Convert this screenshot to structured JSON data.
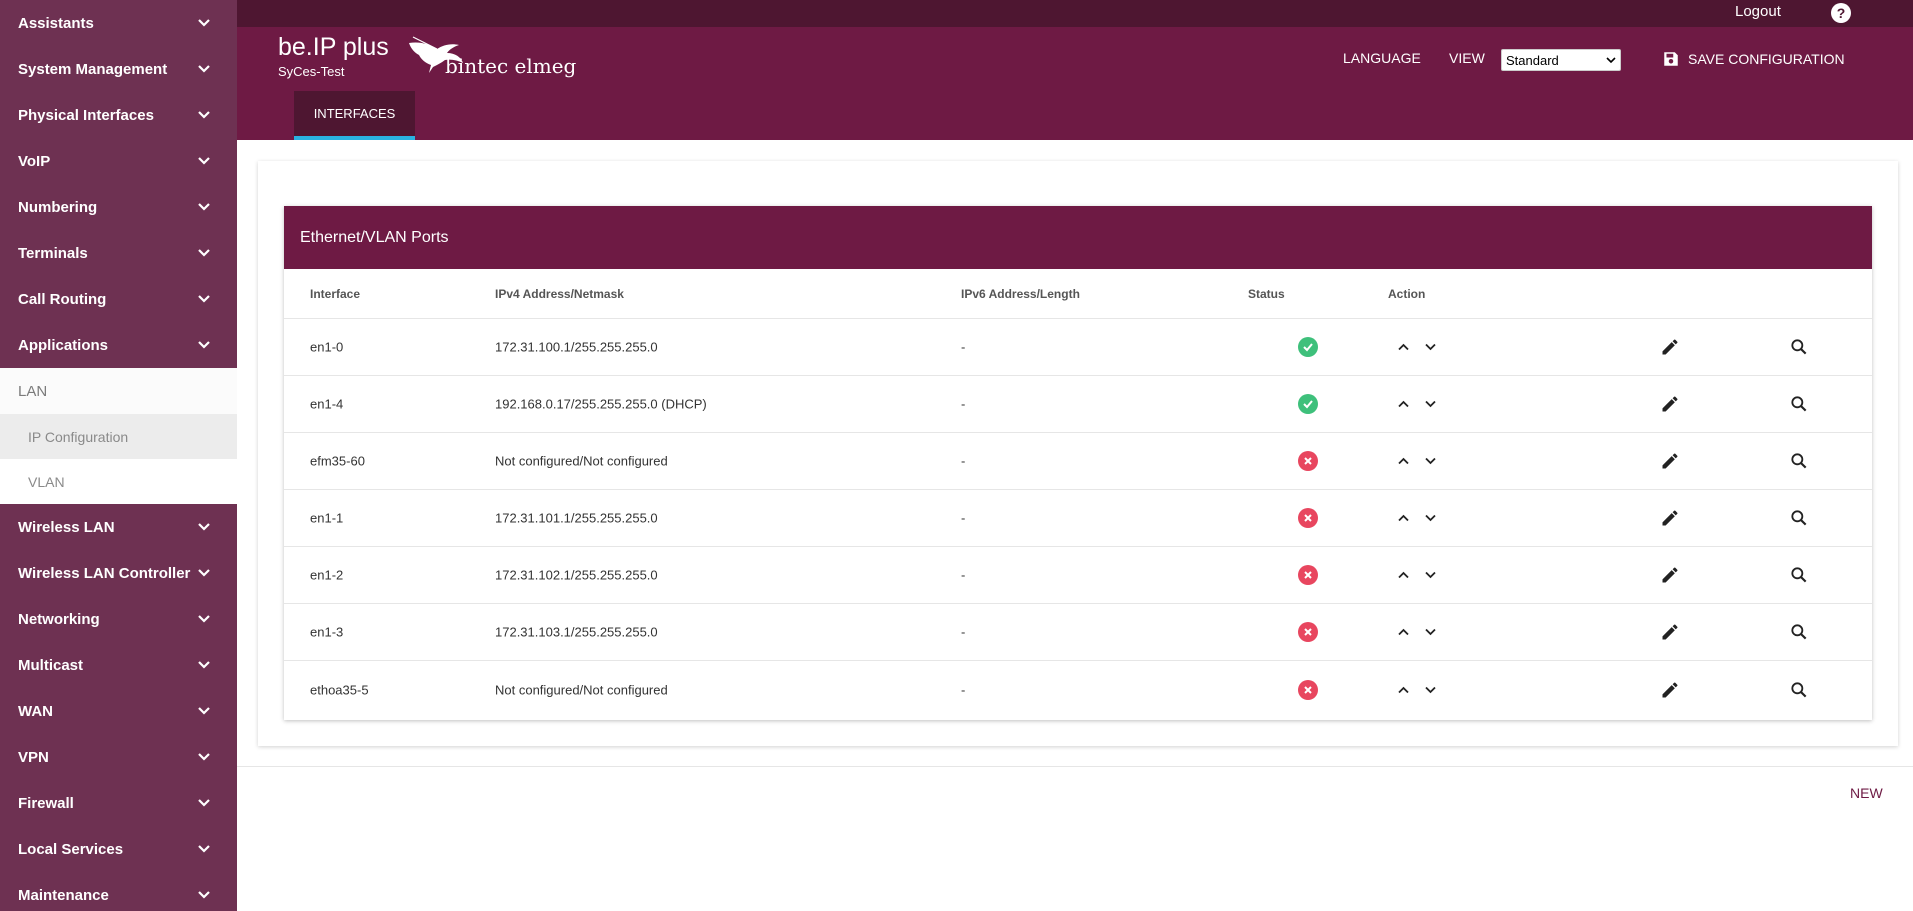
{
  "sidebar": {
    "items_top": [
      {
        "label": "Assistants"
      },
      {
        "label": "System Management"
      },
      {
        "label": "Physical Interfaces"
      },
      {
        "label": "VoIP"
      },
      {
        "label": "Numbering"
      },
      {
        "label": "Terminals"
      },
      {
        "label": "Call Routing"
      },
      {
        "label": "Applications"
      }
    ],
    "lan": {
      "label": "LAN",
      "subitems": [
        {
          "label": "IP Configuration"
        },
        {
          "label": "VLAN"
        }
      ]
    },
    "items_bottom": [
      {
        "label": "Wireless LAN"
      },
      {
        "label": "Wireless LAN Controller"
      },
      {
        "label": "Networking"
      },
      {
        "label": "Multicast"
      },
      {
        "label": "WAN"
      },
      {
        "label": "VPN"
      },
      {
        "label": "Firewall"
      },
      {
        "label": "Local Services"
      },
      {
        "label": "Maintenance"
      }
    ]
  },
  "topbar": {
    "logout": "Logout",
    "help": "?"
  },
  "header": {
    "product": "be.IP plus",
    "device": "SyCes-Test",
    "brand": "bintec elmeg",
    "language": "LANGUAGE",
    "view_label": "VIEW",
    "view_value": "Standard",
    "save": "SAVE CONFIGURATION",
    "tab": "INTERFACES"
  },
  "table": {
    "title": "Ethernet/VLAN Ports",
    "columns": {
      "interface": "Interface",
      "ipv4": "IPv4 Address/Netmask",
      "ipv6": "IPv6 Address/Length",
      "status": "Status",
      "action": "Action"
    },
    "rows": [
      {
        "interface": "en1-0",
        "ipv4": "172.31.100.1/255.255.255.0",
        "ipv6": "-",
        "status": "up"
      },
      {
        "interface": "en1-4",
        "ipv4": "192.168.0.17/255.255.255.0  (DHCP)",
        "ipv6": "-",
        "status": "up"
      },
      {
        "interface": "efm35-60",
        "ipv4": "Not configured/Not configured",
        "ipv6": "-",
        "status": "down"
      },
      {
        "interface": "en1-1",
        "ipv4": "172.31.101.1/255.255.255.0",
        "ipv6": "-",
        "status": "down"
      },
      {
        "interface": "en1-2",
        "ipv4": "172.31.102.1/255.255.255.0",
        "ipv6": "-",
        "status": "down"
      },
      {
        "interface": "en1-3",
        "ipv4": "172.31.103.1/255.255.255.0",
        "ipv6": "-",
        "status": "down"
      },
      {
        "interface": "ethoa35-5",
        "ipv4": "Not configured/Not configured",
        "ipv6": "-",
        "status": "down"
      }
    ]
  },
  "footer": {
    "new": "NEW"
  },
  "colors": {
    "sidebar": "#6e3152",
    "header": "#6e1a44",
    "topbar": "#4e1631",
    "tab_underline": "#2ab2e0",
    "status_ok": "#3ec07b",
    "status_err": "#e8465f"
  }
}
